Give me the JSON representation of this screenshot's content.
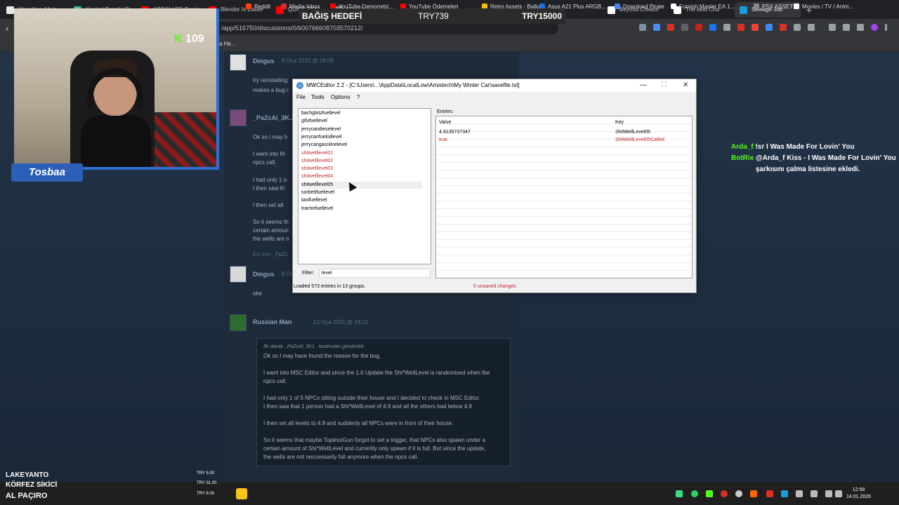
{
  "tabs": [
    {
      "label": "Wrestling_Main",
      "color": "#e8e8e8",
      "active": false
    },
    {
      "label": "Kontrol Paneli | D",
      "color": "#3db8a6",
      "active": false
    },
    {
      "label": "ABSOLUTE Beginn",
      "color": "#ff0000",
      "active": false
    },
    {
      "label": "Blender Is Easier",
      "color": "#ff0000",
      "active": false
    },
    {
      "label": "QUICK TEM",
      "color": "#ff0000",
      "active": false
    },
    {
      "label": "Mesajlar",
      "color": "#888888",
      "active": false
    },
    {
      "label": "Beyond Creator",
      "color": "#ffffff",
      "active": false
    },
    {
      "label": "The best Cha",
      "color": "#ffffff",
      "active": false
    },
    {
      "label": "Sewage Job",
      "color": "#1b9bd8",
      "active": true
    }
  ],
  "url": "/app/516750/discussions/0/600766608703570212/",
  "bookmarks": [
    "Reddit",
    "Media Inbox",
    "YouTube Demonetiz...",
    "YouTube Ödemeleri",
    "Retro Assets - Balka...",
    "Asus A21 Plus ARGB...",
    "Download Pirate",
    "Furnish Master EA 1...",
    "PSX ASSETS",
    "Movies / TV / Anim..."
  ],
  "bookmark_start": "a He...",
  "donation": {
    "label": "BAĞIŞ HEDEFİ",
    "current": "TRY739",
    "goal": "TRY15000"
  },
  "stream": {
    "viewers": "109",
    "name": "Tosbaa"
  },
  "thread": {
    "post1": {
      "name": "Dingus",
      "date": "8 Oca 2025 @ 18:08",
      "lines": [
        "try reinstalling",
        "makes a bug r"
      ]
    },
    "post2": {
      "name": "_PaZcAl_3K...",
      "lines": [
        "Ok so I may h",
        "I went into M",
        "npcs call.",
        "I had only 1 o",
        "I then saw th",
        "I then set all",
        "So it seems th",
        "certain amoun",
        "the wells are n",
        "En son _PaZc"
      ]
    },
    "post3": {
      "name": "Dingus",
      "date": "8 Oca 2025",
      "text": "oke"
    },
    "post4": {
      "name": "Russian Man",
      "date": "13 Oca 2025 @ 19:12"
    },
    "quote": {
      "author": "İlk olarak _PaZcAl_3K1_ tarafından gönderildi:",
      "lines": [
        "Ok so I may have found the reason for the bug.",
        "",
        "I went into MSC Editor and since the 1.0 Update the Shi*WellLevel is randomised when the",
        "npcs call.",
        "",
        "I had only 1 of 5 NPCs sitting outside their house and I decided to check in MSC Editor.",
        "I then saw that 1 person had a Shi*WellLevel of 4.9 and all the others had below 4.9",
        "",
        "I then set all levels to 4.9 and suddenly all NPCs were in front of their house.",
        "",
        "So it seems that maybe ToplessGun forgot to set a trigger, that NPCs also spawn under a",
        "certain amount of Shi*WellLevel and currently only spawn if it is full. But since the update,",
        "the wells are not neccessarily full anymore when the npcs call."
      ]
    }
  },
  "editor": {
    "title": "MWCEditor 2.2 - [C:\\Users\\...\\AppData\\LocalLow\\Amistech\\My Winter Car\\savefile.txt]",
    "menu": [
      "File",
      "Tools",
      "Options",
      "?"
    ],
    "keys": [
      {
        "name": "bachglotzfuellevel",
        "modified": false
      },
      {
        "name": "gifufuellevel",
        "modified": false
      },
      {
        "name": "jerrycandieselevel",
        "modified": false
      },
      {
        "name": "jerrycanfueloillevel",
        "modified": false
      },
      {
        "name": "jerrycangasolinelevel",
        "modified": false
      },
      {
        "name": "shitwelllevel01",
        "modified": true
      },
      {
        "name": "shitwelllevel02",
        "modified": true
      },
      {
        "name": "shitwelllevel03",
        "modified": true
      },
      {
        "name": "shitwelllevel04",
        "modified": true
      },
      {
        "name": "shitwelllevel05",
        "modified": false
      },
      {
        "name": "sorbettfuellevel",
        "modified": false
      },
      {
        "name": "taxifuellevel",
        "modified": false
      },
      {
        "name": "tractorfuellevel",
        "modified": false
      }
    ],
    "filter_label": "Filter:",
    "filter_value": "level",
    "entries_label": "Entries:",
    "columns": [
      "Value",
      "Key"
    ],
    "rows": [
      {
        "value": "4.9135737347",
        "key": "ShitWellLevel05",
        "modified": false
      },
      {
        "value": "true",
        "key": "ShitWellLevel05Called",
        "modified": true
      }
    ],
    "status_left": "Loaded 573 entries in 13 groups.",
    "status_right": "5 unsaved changes"
  },
  "chat": [
    {
      "user": "Arda_f",
      "text": "!sr I Was Made For Lovin' You"
    },
    {
      "user": "BotRix",
      "text": "@Arda_f Kiss - I Was Made For Lovin' You"
    },
    {
      "user": "",
      "text": "şarkısını çalma listesine ekledi."
    }
  ],
  "donors": [
    {
      "name": "LAKEYANTO",
      "amount": "TRY 5.00"
    },
    {
      "name": "KÖRFEZ SİKİCİ",
      "amount": "TRY 31.00"
    },
    {
      "name": "AL PAÇIRO",
      "amount": "TRY 8.00"
    }
  ],
  "clock": {
    "time": "12:58",
    "date": "14.01.2026"
  }
}
